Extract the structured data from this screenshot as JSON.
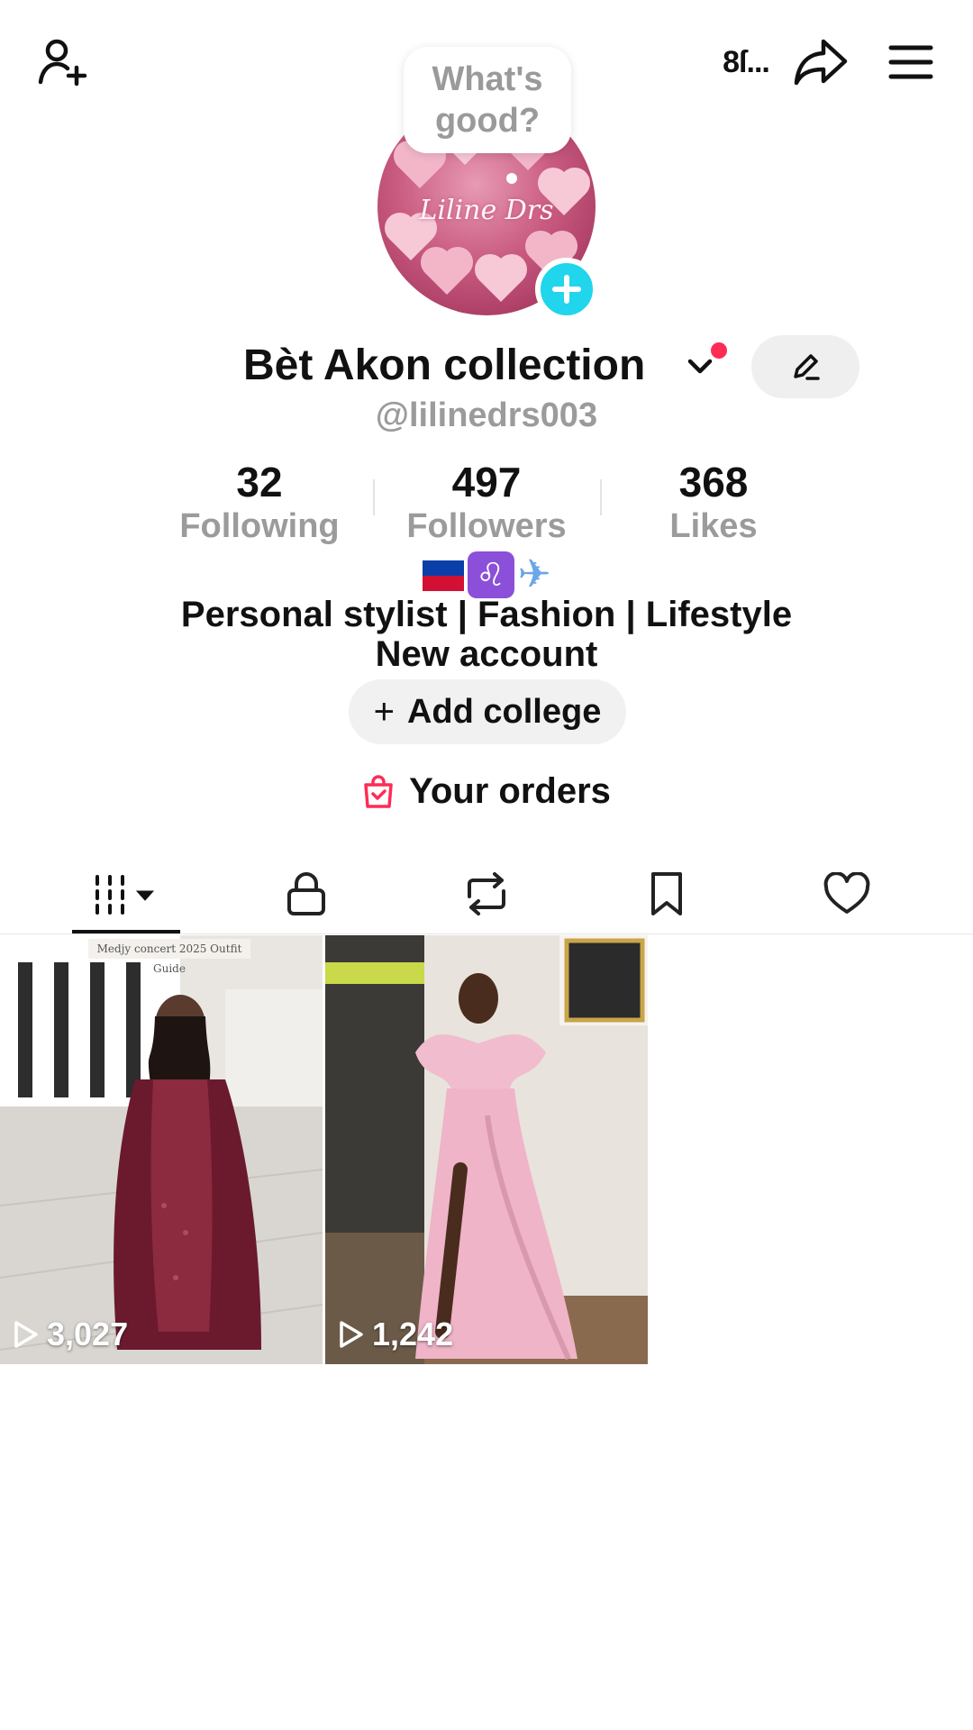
{
  "top_bar": {
    "add_friend_icon": "person-plus-icon",
    "snip_text": "8ſ...",
    "share_icon": "share-arrow-icon",
    "menu_icon": "hamburger-menu-icon"
  },
  "profile": {
    "bubble_text": "What's good?",
    "avatar_signature": "Liline Drs",
    "name": "Bèt Akon collection",
    "handle": "@lilinedrs003"
  },
  "stats": [
    {
      "value": "32",
      "label": "Following"
    },
    {
      "value": "497",
      "label": "Followers"
    },
    {
      "value": "368",
      "label": "Likes"
    }
  ],
  "bio": {
    "emojis": [
      "haiti-flag",
      "leo-sign",
      "airplane"
    ],
    "line1": "Personal stylist | Fashion | Lifestyle",
    "line2": "New account"
  },
  "add_college": {
    "icon": "+",
    "label": "Add college"
  },
  "orders": {
    "label": "Your orders"
  },
  "tabs": [
    {
      "name": "videos",
      "icon": "grid-filter-icon"
    },
    {
      "name": "private",
      "icon": "lock-icon"
    },
    {
      "name": "reposts",
      "icon": "repost-icon"
    },
    {
      "name": "favorites",
      "icon": "bookmark-icon"
    },
    {
      "name": "liked",
      "icon": "heart-icon"
    }
  ],
  "videos": [
    {
      "views": "3,027",
      "caption": "Medjy concert 2025 Outfit Guide"
    },
    {
      "views": "1,242"
    }
  ],
  "colors": {
    "accent_red": "#fe2c55",
    "badge_cyan": "#20d5ec",
    "muted_gray": "#9b9b9b"
  }
}
